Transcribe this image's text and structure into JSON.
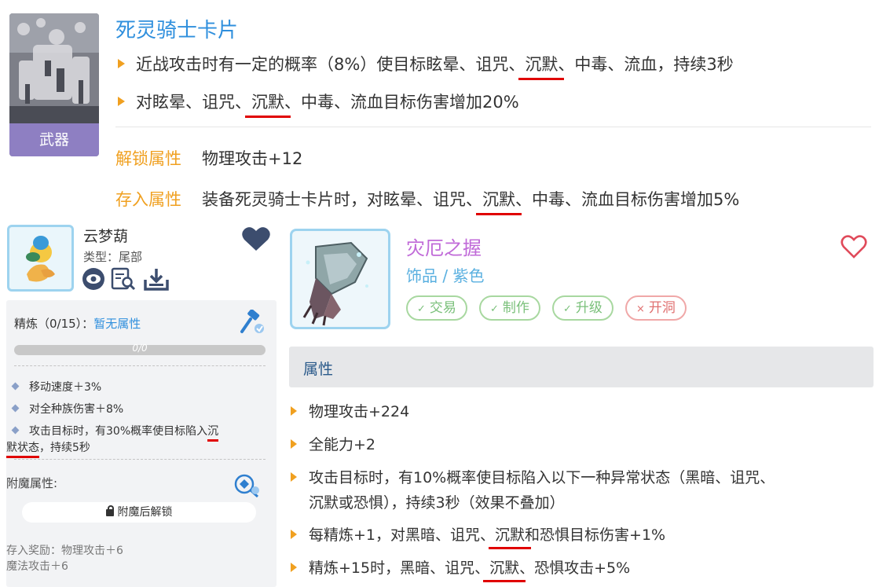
{
  "card": {
    "title": "死灵骑士卡片",
    "badge": "武器",
    "effect1": {
      "before": "近战攻击时有一定的概率（8%）使目标眩晕、诅咒、",
      "highlight": "沉默",
      "after": "、中毒、流血，持续3秒"
    },
    "effect2": {
      "before": "对眩晕、诅咒、",
      "highlight": "沉默",
      "after": "、中毒、流血目标伤害增加20%"
    },
    "unlock": {
      "label": "解锁属性",
      "value": "物理攻击+12"
    },
    "store": {
      "label": "存入属性",
      "before": "装备死灵骑士卡片时，对眩晕、诅咒、",
      "highlight": "沉默",
      "after": "、中毒、流血目标伤害增加5%"
    }
  },
  "pet": {
    "name": "云梦葫",
    "type": "类型：尾部",
    "refine": {
      "label": "精炼（0/15）：",
      "none": "暂无属性",
      "progress_text": "0/0",
      "progress": 0
    },
    "stats": {
      "s1": "移动速度＋3%",
      "s2": "对全种族伤害＋8%",
      "s3_before": "攻击目标时，有30%概率使目标陷入",
      "s3_hl1": "沉",
      "s3b_hl2": "默状态",
      "s3b_after": "，持续5秒"
    },
    "enchant": {
      "label": "附魔属性:",
      "unlock": "附魔后解锁"
    },
    "store_bonus_1": "存入奖励：物理攻击＋6",
    "store_bonus_2": "魔法攻击＋6"
  },
  "item": {
    "name": "灾厄之握",
    "sub": "饰品 / 紫色",
    "tags": {
      "trade": "交易",
      "craft": "制作",
      "upgrade": "升级",
      "socket": "开洞"
    },
    "attr_header": "属性",
    "attrs": {
      "a1": "物理攻击+224",
      "a2": "全能力+2",
      "a3": "攻击目标时，有10%概率使目标陷入以下一种异常状态（黑暗、诅咒、",
      "a3b": "沉默或恐惧），持续3秒（效果不叠加）",
      "a4_before": "每精炼+1，对黑暗、诅咒、",
      "a4_hl": "沉默",
      "a4_after": "和恐惧目标伤害+1%",
      "a5_before": "精炼+15时，黑暗、诅咒、",
      "a5_hl": "沉默",
      "a5_after": "、恐惧攻击+5%"
    }
  },
  "colors": {
    "title_blue": "#2f8fdd",
    "accent_orange": "#f0a020",
    "item_purple": "#c06ad8",
    "highlight_red": "#e00000",
    "badge_purple": "#8e7fc2"
  }
}
